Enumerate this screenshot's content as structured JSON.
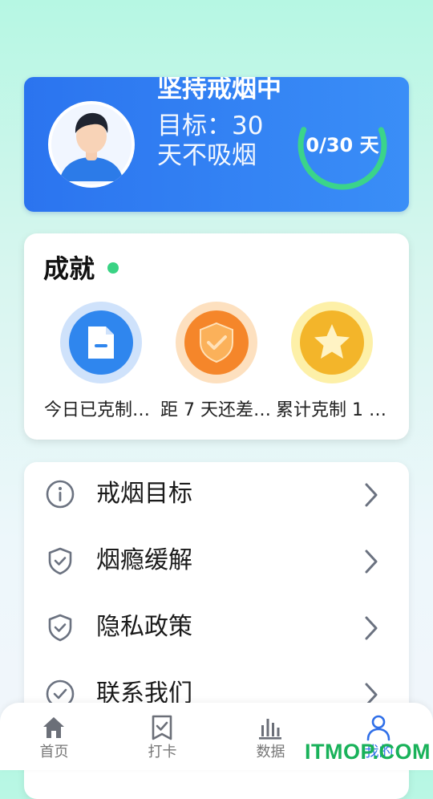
{
  "profile": {
    "status_title": "坚持戒烟中",
    "goal_text": "目标：30天不吸烟",
    "progress_label": "0/30 天",
    "progress_fraction": 0.62,
    "card_color": "#2b74ef",
    "ring_color": "#3bd48a"
  },
  "achievements": {
    "title": "成就",
    "status_dot_color": "#3ad384",
    "items": [
      {
        "label": "今日已克制…",
        "icon": "document-icon",
        "color": "#2f86ee"
      },
      {
        "label": "距 7 天还差…",
        "icon": "shield-check-icon",
        "color": "#f5862a"
      },
      {
        "label": "累计克制 1 …",
        "icon": "star-icon",
        "color": "#f3b52a"
      }
    ]
  },
  "menu": {
    "items": [
      {
        "label": "戒烟目标",
        "icon": "info-icon"
      },
      {
        "label": "烟瘾缓解",
        "icon": "shield-check-icon"
      },
      {
        "label": "隐私政策",
        "icon": "shield-check-icon"
      },
      {
        "label": "联系我们",
        "icon": "check-circle-icon"
      }
    ]
  },
  "bottom_nav": {
    "items": [
      {
        "label": "首页",
        "icon": "home-icon",
        "active": false
      },
      {
        "label": "打卡",
        "icon": "bookmark-check-icon",
        "active": false
      },
      {
        "label": "数据",
        "icon": "bar-chart-icon",
        "active": false
      },
      {
        "label": "我的",
        "icon": "user-icon",
        "active": true
      }
    ],
    "active_color": "#2f6fe8"
  },
  "watermark": "ITMOP.COM"
}
